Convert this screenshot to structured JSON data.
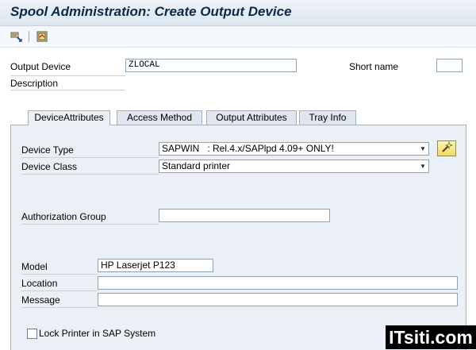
{
  "window": {
    "title": "Spool Administration: Create Output Device"
  },
  "toolbar": {
    "icons": [
      "connect-icon",
      "display-change-icon"
    ]
  },
  "header": {
    "output_device_label": "Output Device",
    "output_device_value": "ZLOCAL",
    "short_name_label": "Short name",
    "short_name_value": "",
    "description_label": "Description"
  },
  "tabs": [
    {
      "label": "DeviceAttributes",
      "active": true
    },
    {
      "label": "Access Method",
      "active": false
    },
    {
      "label": "Output Attributes",
      "active": false
    },
    {
      "label": "Tray Info",
      "active": false
    }
  ],
  "device_attributes": {
    "device_type_label": "Device Type",
    "device_type_value": "SAPWIN   : Rel.4.x/SAPlpd 4.09+ ONLY!",
    "device_class_label": "Device Class",
    "device_class_value": "Standard printer",
    "authorization_group_label": "Authorization Group",
    "authorization_group_value": "",
    "model_label": "Model",
    "model_value": "HP Laserjet P123",
    "location_label": "Location",
    "location_value": "",
    "message_label": "Message",
    "message_value": "",
    "lock_printer_label": "Lock Printer in SAP System",
    "lock_printer_checked": false
  },
  "watermark": {
    "text": "ITsiti.com"
  }
}
